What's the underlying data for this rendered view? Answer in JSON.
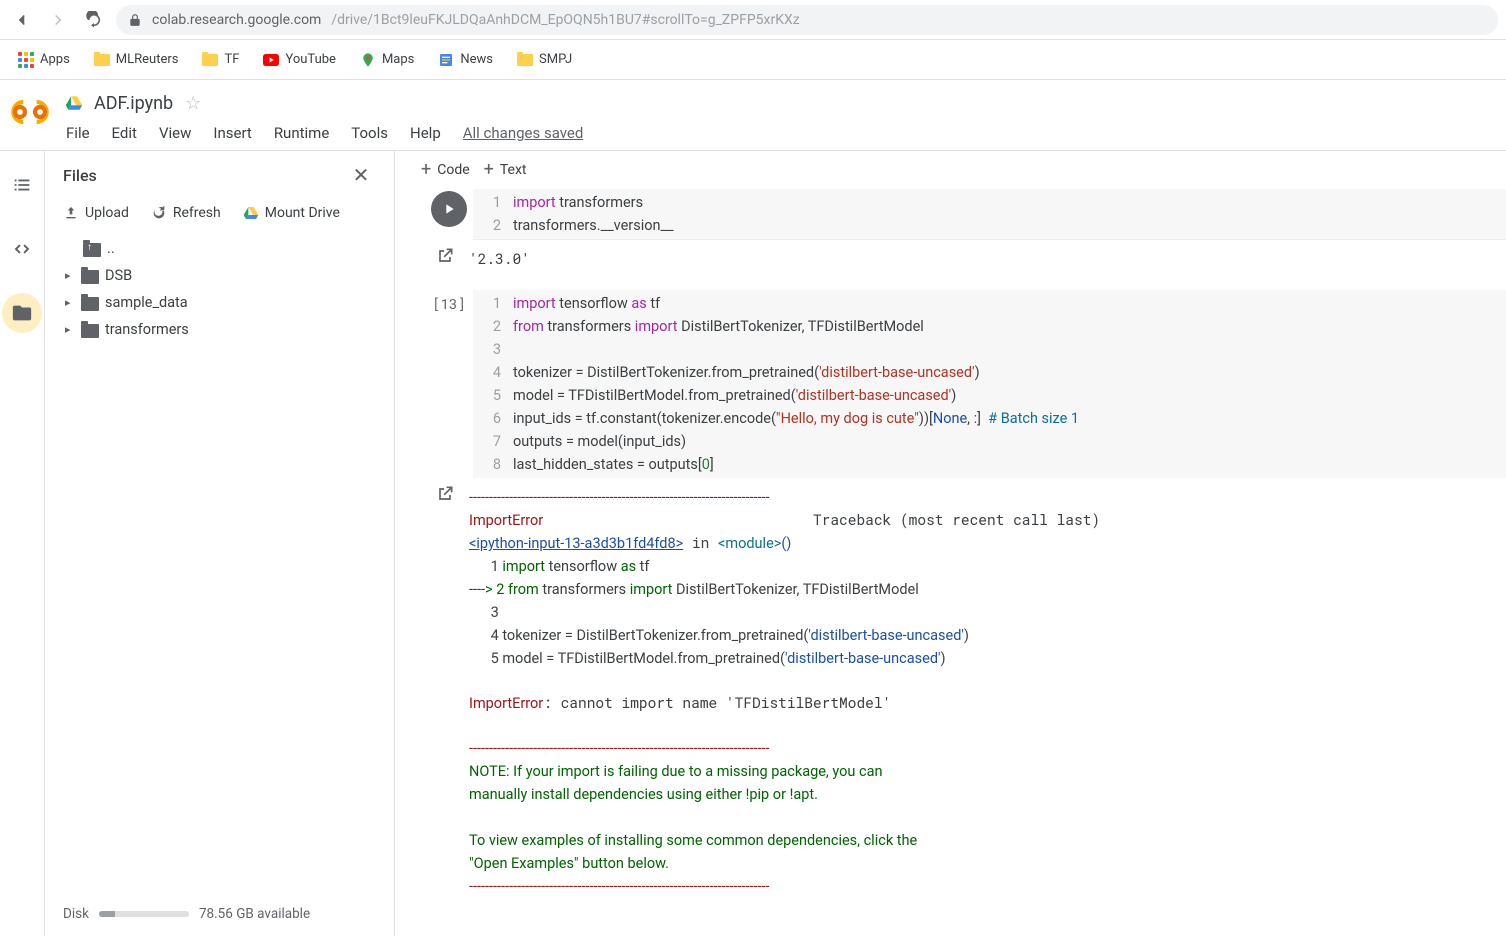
{
  "url": {
    "host": "colab.research.google.com",
    "path": "/drive/1Bct9leuFKJLDQaAnhDCM_EpOQN5h1BU7#scrollTo=g_ZPFP5xrKXz"
  },
  "bookmarks": [
    {
      "label": "Apps",
      "type": "apps"
    },
    {
      "label": "MLReuters",
      "type": "folder"
    },
    {
      "label": "TF",
      "type": "folder"
    },
    {
      "label": "YouTube",
      "type": "yt"
    },
    {
      "label": "Maps",
      "type": "maps"
    },
    {
      "label": "News",
      "type": "news"
    },
    {
      "label": "SMPJ",
      "type": "folder"
    }
  ],
  "doc": {
    "title": "ADF.ipynb"
  },
  "menus": [
    "File",
    "Edit",
    "View",
    "Insert",
    "Runtime",
    "Tools",
    "Help"
  ],
  "saved": "All changes saved",
  "side": {
    "title": "Files",
    "actions": {
      "upload": "Upload",
      "refresh": "Refresh",
      "mount": "Mount Drive"
    },
    "tree": [
      {
        "label": "..",
        "up": true
      },
      {
        "label": "DSB"
      },
      {
        "label": "sample_data"
      },
      {
        "label": "transformers"
      }
    ]
  },
  "disk": {
    "label": "Disk",
    "percent": 18,
    "avail": "78.56 GB available"
  },
  "toolbar": {
    "code": "Code",
    "text": "Text"
  },
  "cell1": {
    "lines": [
      [
        {
          "t": "import",
          "c": "kw"
        },
        {
          "t": " transformers"
        }
      ],
      [
        {
          "t": "transformers.__version__"
        }
      ]
    ],
    "output": "'2.3.0'"
  },
  "cell2": {
    "exec": "[13]",
    "lines": [
      [
        {
          "t": "import",
          "c": "kw"
        },
        {
          "t": " tensorflow "
        },
        {
          "t": "as",
          "c": "kw"
        },
        {
          "t": " tf"
        }
      ],
      [
        {
          "t": "from",
          "c": "kw"
        },
        {
          "t": " transformers "
        },
        {
          "t": "import",
          "c": "kw"
        },
        {
          "t": " DistilBertTokenizer, TFDistilBertModel"
        }
      ],
      [],
      [
        {
          "t": "tokenizer = DistilBertTokenizer.from_pretrained("
        },
        {
          "t": "'distilbert-base-uncased'",
          "c": "str"
        },
        {
          "t": ")"
        }
      ],
      [
        {
          "t": "model = TFDistilBertModel.from_pretrained("
        },
        {
          "t": "'distilbert-base-uncased'",
          "c": "str"
        },
        {
          "t": ")"
        }
      ],
      [
        {
          "t": "input_ids = tf.constant(tokenizer.encode("
        },
        {
          "t": "\"Hello, my dog is cute\"",
          "c": "str"
        },
        {
          "t": "))["
        },
        {
          "t": "None",
          "c": "none"
        },
        {
          "t": ", :]  "
        },
        {
          "t": "# Batch size 1",
          "c": "com"
        }
      ],
      [
        {
          "t": "outputs = model(input_ids)"
        }
      ],
      [
        {
          "t": "last_hidden_states = outputs["
        },
        {
          "t": "0",
          "c": "num"
        },
        {
          "t": "]"
        }
      ]
    ],
    "error": {
      "dash": "---------------------------------------------------------------------------",
      "head_l": "ImportError",
      "head_r": "Traceback (most recent call last)",
      "frame_link": "<ipython-input-13-a3d3b1fd4fd8>",
      "frame_in": " in ",
      "frame_mod": "<module>",
      "frame_par": "()",
      "lines": [
        {
          "n": "      1 ",
          "body": [
            {
              "t": "import ",
              "c": "err-green"
            },
            {
              "t": "tensorflow ",
              "c": ""
            },
            {
              "t": "as ",
              "c": "err-green"
            },
            {
              "t": "tf",
              "c": ""
            }
          ]
        },
        {
          "n": "----> 2 ",
          "arrow": true,
          "body": [
            {
              "t": "from ",
              "c": "err-green"
            },
            {
              "t": "transformers ",
              "c": ""
            },
            {
              "t": "import ",
              "c": "err-green"
            },
            {
              "t": "DistilBertTokenizer, TFDistilBertModel",
              "c": ""
            }
          ]
        },
        {
          "n": "      3 ",
          "body": []
        },
        {
          "n": "      4 ",
          "body": [
            {
              "t": "tokenizer = DistilBertTokenizer.from_pretrained(",
              "c": ""
            },
            {
              "t": "'distilbert-base-uncased'",
              "c": "err-blue"
            },
            {
              "t": ")",
              "c": ""
            }
          ]
        },
        {
          "n": "      5 ",
          "body": [
            {
              "t": "model = TFDistilBertModel.from_pretrained(",
              "c": ""
            },
            {
              "t": "'distilbert-base-uncased'",
              "c": "err-blue"
            },
            {
              "t": ")",
              "c": ""
            }
          ]
        }
      ],
      "msg_l": "ImportError",
      "msg_r": ": cannot import name 'TFDistilBertModel'",
      "note": [
        "NOTE: If your import is failing due to a missing package, you can",
        "manually install dependencies using either !pip or !apt.",
        "",
        "To view examples of installing some common dependencies, click the",
        "\"Open Examples\" button below."
      ],
      "dashbot": "---------------------------------------------------------------------------"
    }
  }
}
